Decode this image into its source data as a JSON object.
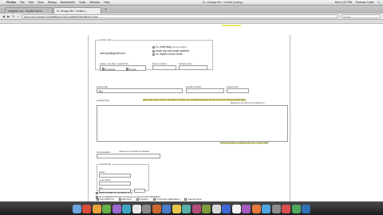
{
  "os_menubar": {
    "menus": [
      "Firefox",
      "File",
      "Edit",
      "View",
      "History",
      "Bookmarks",
      "Tools",
      "Window",
      "Help"
    ],
    "window_title": "CL chicago life > create posting",
    "clock": "Mon 4:23 PM",
    "user": "Thomas Curtis"
  },
  "browser": {
    "tabs": [
      {
        "label": "craigslist.com - Mozilla Firefox"
      },
      {
        "label": "CL chicago life > create p..."
      }
    ],
    "url": "https://post.craigslist.org/k/3l5j0mHuT4mKxE0t8P7jX9Q/ldBsP?s=edit",
    "search_placeholder": "Google"
  },
  "form": {
    "contact_legend": "contact info",
    "email": "userxyz@gmail.com",
    "reply_options": [
      {
        "label": "CL mail relay",
        "hint": "(recommended)",
        "checked": true
      },
      {
        "label": "show my real email address",
        "hint": "",
        "checked": false
      },
      {
        "label": "no replies to this email",
        "hint": "",
        "checked": false
      }
    ],
    "contact_prompt": "please use other contact info",
    "by_phone": "by phone",
    "by_text": "by text",
    "phone_number_label": "phone number",
    "contact_name_label": "contact name",
    "posting_title_label": "posting title",
    "posting_title_value": "Ru",
    "specific_location_label": "specific location",
    "postal_code_label": "postal code",
    "posting_body_label": "posting body",
    "email_notice": "please enter phone numbers as contact info above, not in posting body (leave this and next field for ad) see posting spam",
    "html_notice": "Please see our FAQ on our posting's (e)",
    "body_footer_hint": "FAQ tag for beater on posting. please use it, in topic upload",
    "compensation_label": "compensation",
    "compensation_hint": "(please be as specific as possible)",
    "street_map_legend": "street/map",
    "street_label": "street",
    "cross_street_label": "cross street",
    "city_label": "city",
    "employment": {
      "options": [
        "internship/ no",
        "part-time",
        "contract",
        "non-profit organization",
        "telecommute"
      ],
      "direct_contact": "direct contact by recruiters is ok",
      "disability": "ok to highlight this job opening for persons with disabilities"
    }
  },
  "dock_colors": [
    "#6ca6e0",
    "#d94d3a",
    "#e8a33b",
    "#66b04a",
    "#9c6ad1",
    "#3fa7c2",
    "#e8e8e8",
    "#8b8b8b",
    "#c96a2f",
    "#4a7cc9",
    "#e6c44a",
    "#58b0a8",
    "#b34d79",
    "#7d9c3b",
    "#d6d6d6",
    "#3e6ad6",
    "#f2f2f2",
    "#a65cbd",
    "#e57a3b",
    "#4fa6e6",
    "#8c8c8c",
    "#d94f4f",
    "#50a65c",
    "#2f6fb5"
  ]
}
